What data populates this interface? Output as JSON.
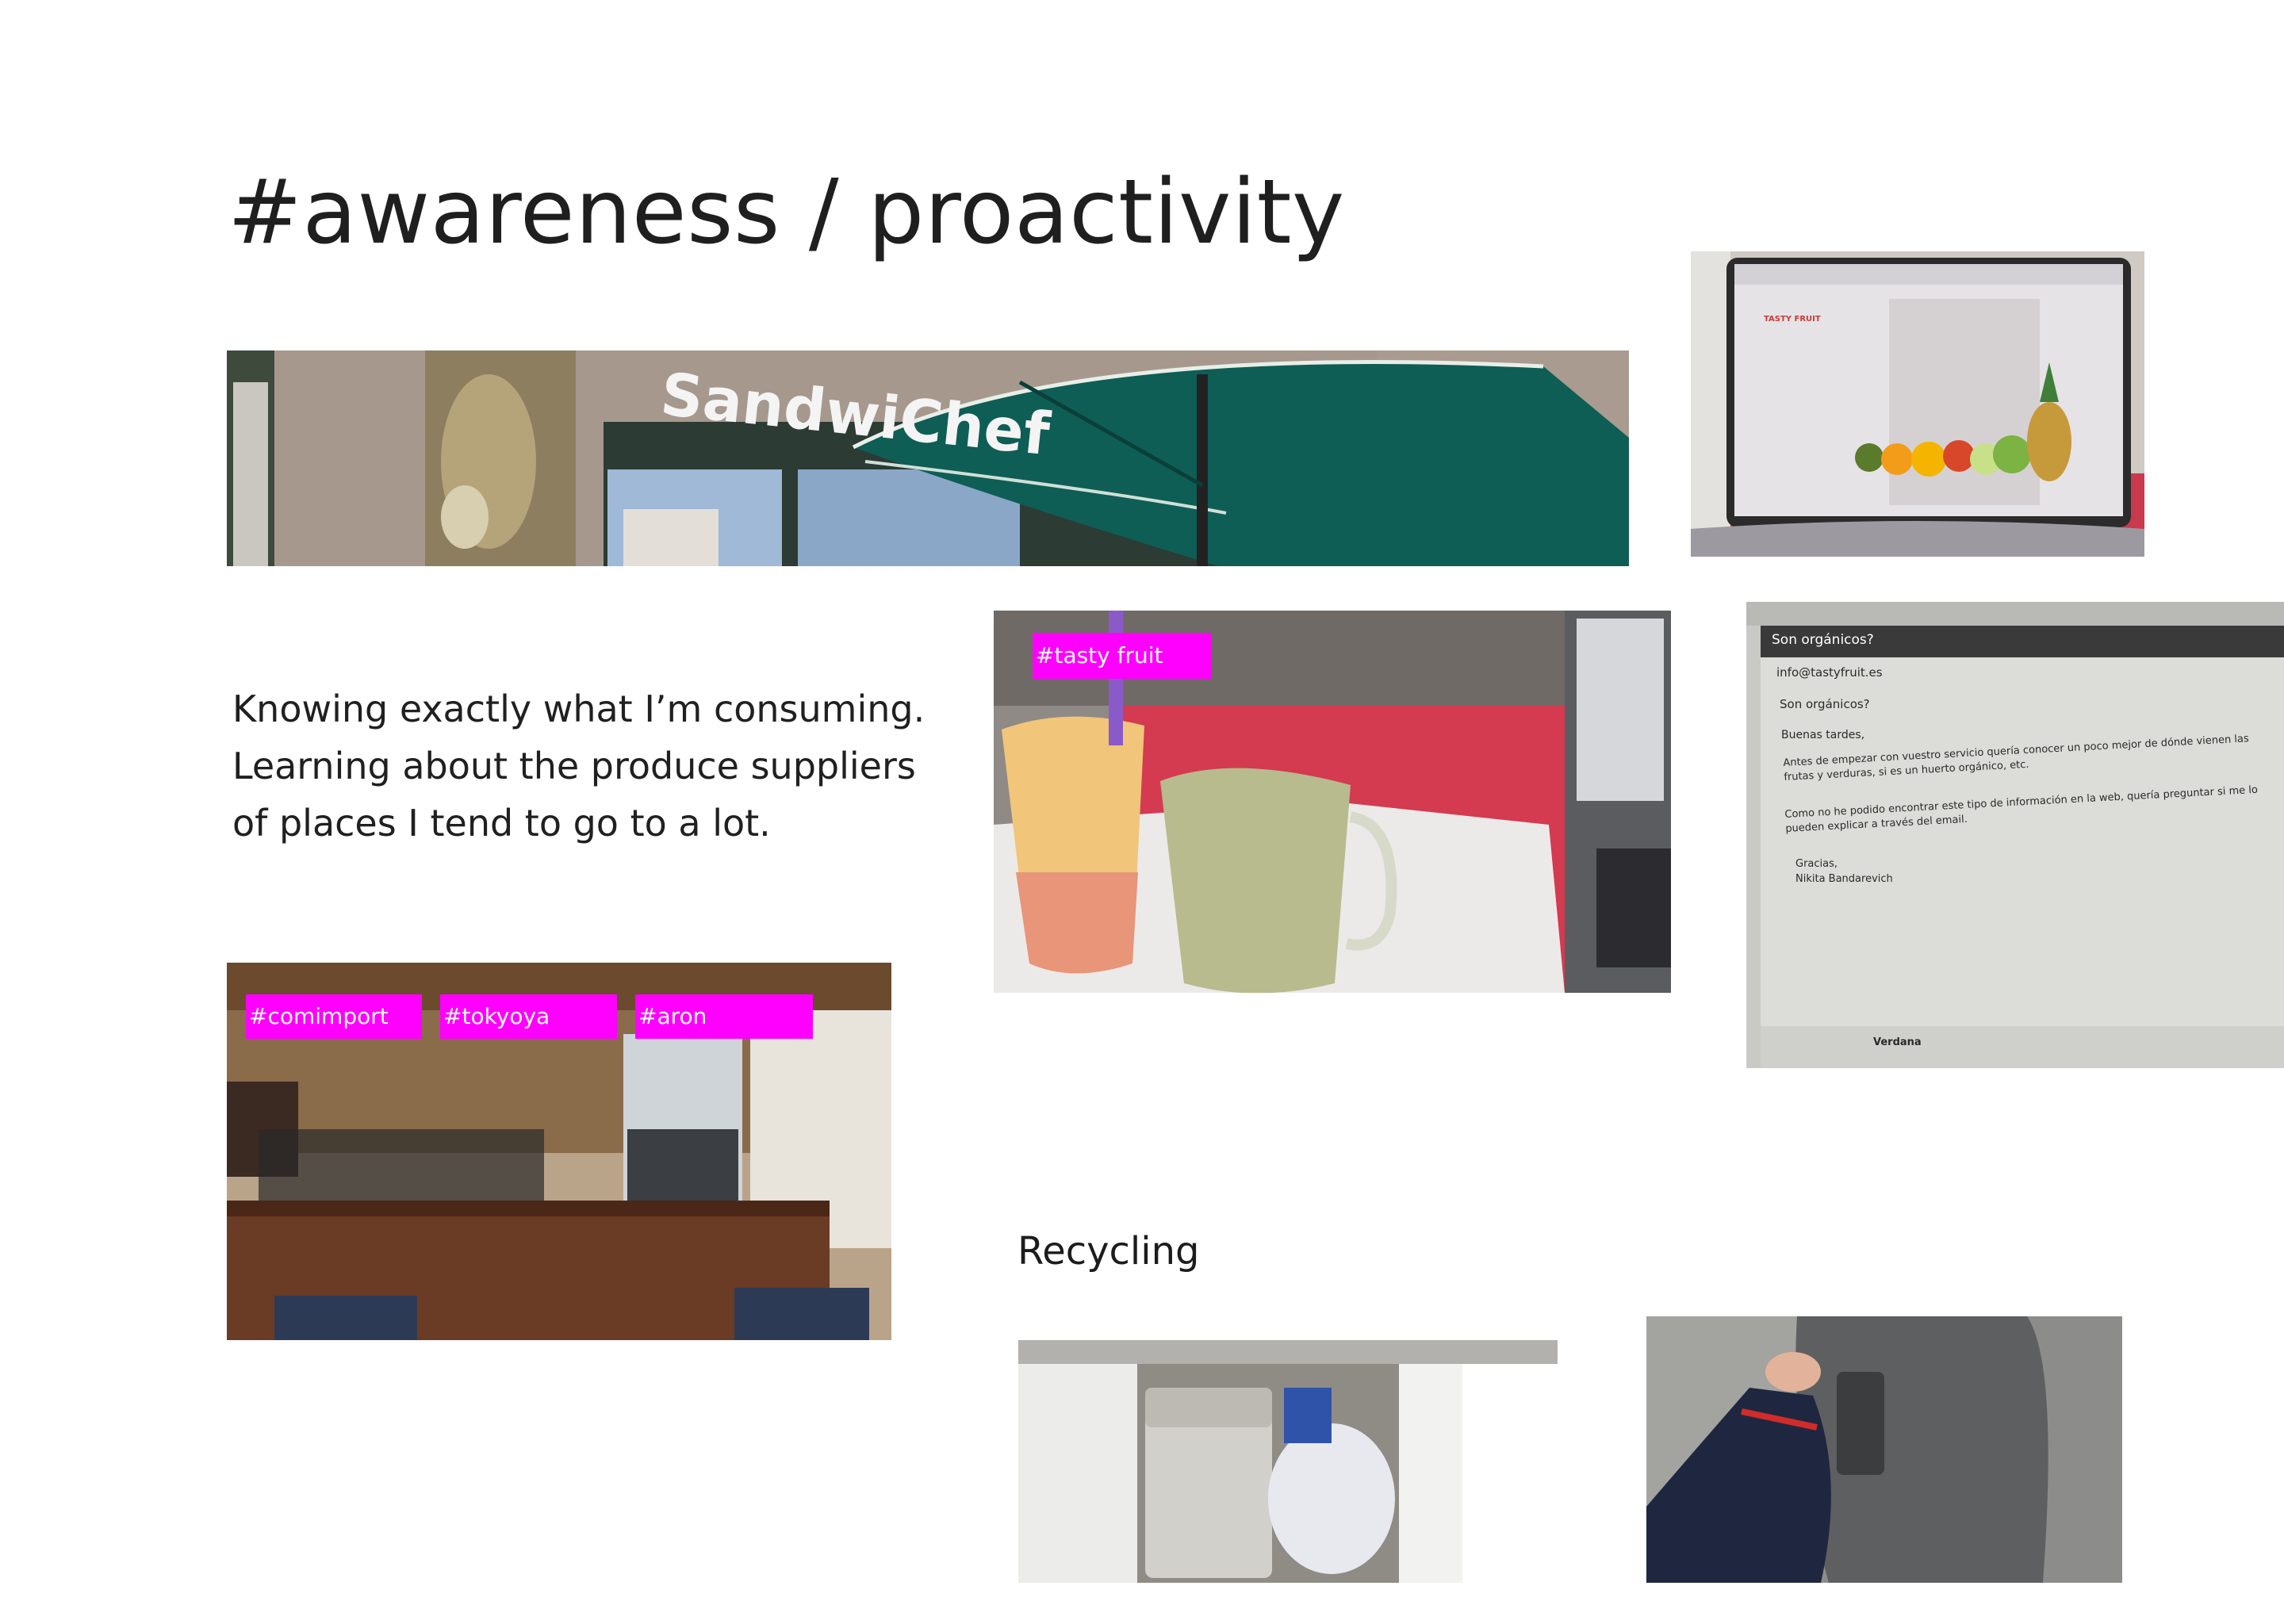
{
  "page": {
    "title": "#awareness / proactivity",
    "body_lines": [
      "Knowing exactly what I’m consuming.",
      "Learning about the produce suppliers",
      "of places I tend to go to a lot."
    ],
    "recycling_heading": "Recycling"
  },
  "photos": {
    "storefront": {
      "sign_text": "SandwiChef"
    },
    "laptop_site": {
      "logo_text": "TASTY FRUIT"
    },
    "drinks": {
      "tag": "#tasty fruit"
    },
    "cafe_counter": {
      "tags": [
        "#comimport",
        "#tokyoya",
        "#aron"
      ]
    },
    "email": {
      "subject": "Son orgánicos?",
      "to": "info@tastyfruit.es",
      "subject_line": "Son orgánicos?",
      "greeting": "Buenas tardes,",
      "paragraph_1": "Antes de empezar con vuestro servicio quería conocer un poco mejor de dónde vienen las frutas y verduras, si es un huerto orgánico, etc.",
      "paragraph_2": "Como no he podido encontrar este tipo de información en la web, quería preguntar si me lo pueden explicar a través del email.",
      "closing": "Gracias,",
      "signature": "Nikita Bandarevich",
      "font_selector": "Verdana"
    },
    "bins": {},
    "street_bin": {}
  },
  "colors": {
    "tag_magenta": "#ff00ff",
    "text": "#1f1f1f",
    "umbrella_green": "#0e5e55",
    "table_red": "#d9384f"
  }
}
